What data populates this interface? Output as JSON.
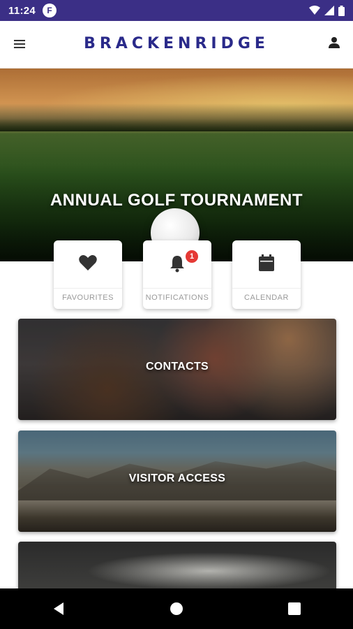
{
  "status_bar": {
    "time": "11:24",
    "app_icon_letter": "F"
  },
  "header": {
    "brand": "BRACKENRIDGE"
  },
  "hero": {
    "title": "ANNUAL GOLF TOURNAMENT"
  },
  "quick_links": [
    {
      "label": "FAVOURITES",
      "icon": "heart-icon"
    },
    {
      "label": "NOTIFICATIONS",
      "icon": "bell-icon",
      "badge": "1"
    },
    {
      "label": "CALENDAR",
      "icon": "calendar-icon"
    }
  ],
  "cards": [
    {
      "label": "CONTACTS"
    },
    {
      "label": "VISITOR ACCESS"
    },
    {
      "label": ""
    }
  ],
  "colors": {
    "status_bar": "#3b2f86",
    "brand": "#2a2a8a",
    "badge": "#e53935"
  }
}
